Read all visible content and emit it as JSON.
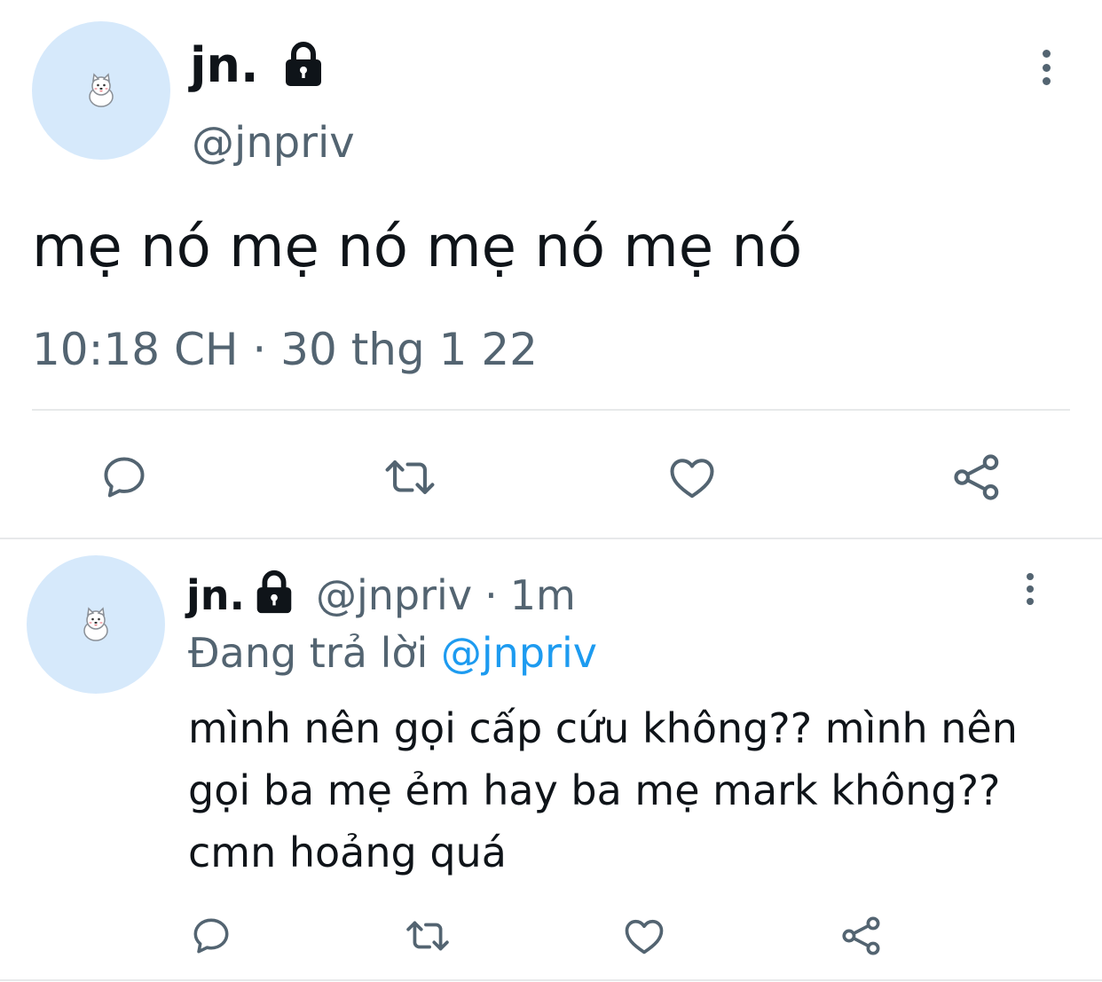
{
  "main_tweet": {
    "avatar_icon": "samoyed-dog-icon",
    "display_name": "jn.",
    "lock_icon": "lock-icon",
    "handle": "@jnpriv",
    "more_icon": "more-vertical-icon",
    "text": "mẹ nó mẹ nó mẹ nó mẹ nó",
    "timestamp": "10:18 CH · 30 thg 1 22",
    "actions": {
      "reply_icon": "reply-icon",
      "retweet_icon": "retweet-icon",
      "like_icon": "heart-icon",
      "share_icon": "share-icon"
    }
  },
  "reply_tweet": {
    "avatar_icon": "samoyed-dog-icon",
    "display_name": "jn.",
    "lock_icon": "lock-icon",
    "handle": "@jnpriv",
    "separator": "·",
    "time_ago": "1m",
    "more_icon": "more-vertical-icon",
    "replying_to_label": "Đang trả lời",
    "replying_to_handle": "@jnpriv",
    "text": "mình nên gọi cấp cứu không?? mình nên gọi ba mẹ ẻm hay ba mẹ mark không?? cmn hoảng quá",
    "actions": {
      "reply_icon": "reply-icon",
      "retweet_icon": "retweet-icon",
      "like_icon": "heart-icon",
      "share_icon": "share-icon"
    }
  },
  "colors": {
    "text_primary": "#0f1419",
    "text_secondary": "#536471",
    "mention": "#1d9bf0",
    "avatar_bg": "#d6e9fb",
    "divider": "#e7e9ea"
  }
}
